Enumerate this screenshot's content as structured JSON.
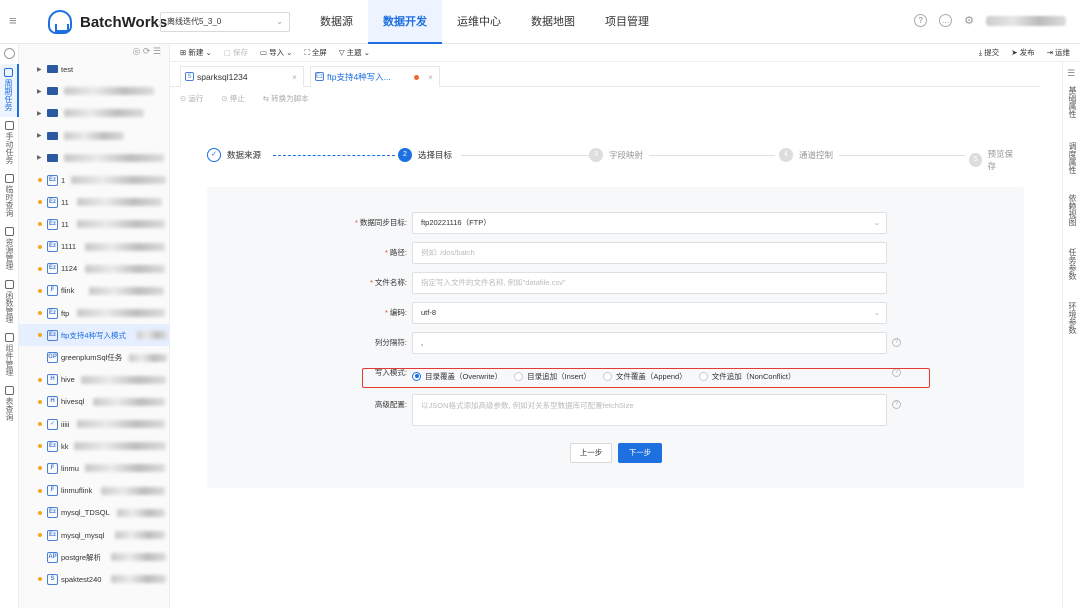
{
  "app": {
    "name": "BatchWorks",
    "project": "离线迭代5_3_0"
  },
  "topnav": [
    "数据源",
    "数据开发",
    "运维中心",
    "数据地图",
    "项目管理"
  ],
  "leftrail": [
    "周期任务",
    "手动任务",
    "临时查询",
    "资源管理",
    "函数管理",
    "组件管理",
    "表查询"
  ],
  "tree": {
    "folders": [
      "test",
      "",
      "",
      "",
      ""
    ],
    "items": [
      {
        "name": "1",
        "icon": "Ez"
      },
      {
        "name": "11",
        "icon": "Ez"
      },
      {
        "name": "11",
        "icon": "Ez"
      },
      {
        "name": "1111",
        "icon": "Ez"
      },
      {
        "name": "1124",
        "icon": "Ez"
      },
      {
        "name": "flink",
        "icon": "F"
      },
      {
        "name": "ftp",
        "icon": "Ez"
      },
      {
        "name": "ftp支持4种写入模式",
        "icon": "Ez"
      },
      {
        "name": "greenplumSql任务",
        "icon": "GP"
      },
      {
        "name": "hive",
        "icon": "H"
      },
      {
        "name": "hivesql",
        "icon": "H"
      },
      {
        "name": "iiiii",
        "icon": "✓"
      },
      {
        "name": "kk",
        "icon": "Ez"
      },
      {
        "name": "linmu",
        "icon": "F"
      },
      {
        "name": "linmuflink",
        "icon": "F"
      },
      {
        "name": "mysql_TDSQL",
        "icon": "Ez"
      },
      {
        "name": "mysql_mysql",
        "icon": "Ez"
      },
      {
        "name": "postgre解析",
        "icon": "AP"
      },
      {
        "name": "spaktest240",
        "icon": "S"
      }
    ]
  },
  "toolbar": {
    "new": "新建",
    "save": "保存",
    "import": "导入",
    "fullscreen": "全屏",
    "theme": "主题",
    "submit": "提交",
    "publish": "发布",
    "ops": "运维"
  },
  "tabs": [
    {
      "label": "sparksql1234",
      "icon": "S"
    },
    {
      "label": "ftp支持4种写入...",
      "icon": "Ez"
    }
  ],
  "runbar": {
    "run": "运行",
    "stop": "停止",
    "convert": "转换为脚本"
  },
  "rightrail": [
    "基础属性",
    "调度属性",
    "依赖视图",
    "任务参数",
    "环境参数"
  ],
  "steps": [
    {
      "num": "✓",
      "label": "数据来源"
    },
    {
      "num": "2",
      "label": "选择目标"
    },
    {
      "num": "3",
      "label": "字段映射"
    },
    {
      "num": "4",
      "label": "通道控制"
    },
    {
      "num": "5",
      "label": "预览保存"
    }
  ],
  "form": {
    "target_label": "数据同步目标:",
    "target_value": "ftp20221116（FTP）",
    "path_label": "路径:",
    "path_placeholder": "例如: /dos/batch",
    "filename_label": "文件名称:",
    "filename_placeholder": "指定写入文件的文件名称, 例如\"datafile.csv\"",
    "encoding_label": "编码:",
    "encoding_value": "utf-8",
    "delimiter_label": "列分隔符:",
    "delimiter_value": ",",
    "writemode_label": "写入模式:",
    "writemode_options": [
      "目录覆盖（Overwrite）",
      "目录追加（Insert）",
      "文件覆盖（Append）",
      "文件追加（NonConflict）"
    ],
    "writemode_selected": 0,
    "advanced_label": "高级配置:",
    "advanced_placeholder": "以JSON格式添加高级参数, 例如对关系型数据库可配置fetchSize"
  },
  "buttons": {
    "prev": "上一步",
    "next": "下一步"
  }
}
